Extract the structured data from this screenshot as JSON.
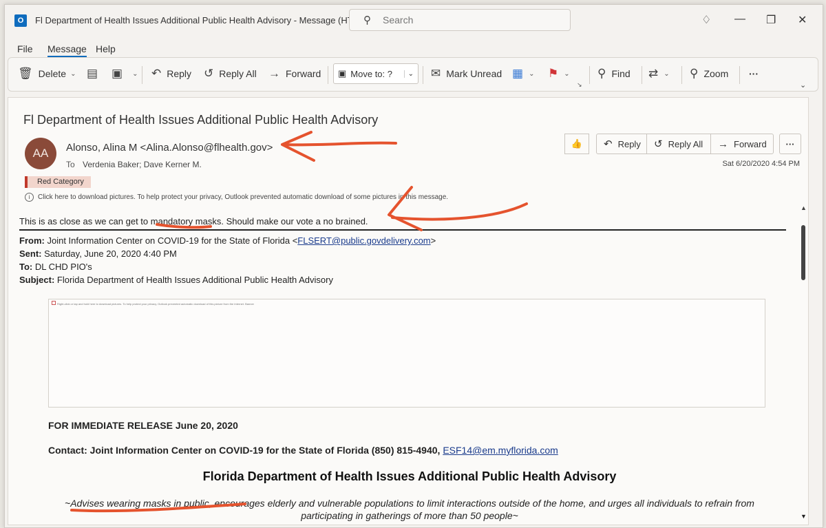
{
  "window": {
    "app_icon": "O",
    "title": "Fl Department of Health Issues Additional Public Health Advisory  -  Message (HTML)",
    "search_placeholder": "Search",
    "controls": [
      "diamond-icon",
      "minimize-icon",
      "restore-icon",
      "close-icon"
    ]
  },
  "menu": {
    "tabs": [
      {
        "label": "File"
      },
      {
        "label": "Message",
        "active": true
      },
      {
        "label": "Help"
      }
    ]
  },
  "ribbon": {
    "delete": "Delete",
    "reply": "Reply",
    "reply_all": "Reply All",
    "forward": "Forward",
    "move_to": "Move to: ?",
    "mark_unread": "Mark Unread",
    "find": "Find",
    "zoom": "Zoom",
    "more": "···"
  },
  "message": {
    "subject": "Fl Department of Health Issues Additional Public Health Advisory",
    "avatar_initials": "AA",
    "sender": "Alonso, Alina M <Alina.Alonso@flhealth.gov>",
    "to_label": "To",
    "recipients": "Verdenia Baker; Dave Kerner M.",
    "category": "Red Category",
    "info_bar": "Click here to download pictures. To help protect your privacy, Outlook prevented automatic download of some pictures in this message.",
    "datetime": "Sat 6/20/2020 4:54 PM",
    "actions": {
      "reply": "Reply",
      "reply_all": "Reply All",
      "forward": "Forward",
      "more": "···"
    },
    "body_line": "This is as close as we can get to mandatory masks. Should make our vote a no brained.",
    "forward_header": {
      "from_label": "From:",
      "from_text": "Joint Information Center on COVID-19 for the State of Florida <",
      "from_email": "FLSERT@public.govdelivery.com",
      "from_close": ">",
      "sent_label": "Sent:",
      "sent_value": "Saturday, June 20, 2020 4:40 PM",
      "to_label": "To:",
      "to_value": "DL CHD PIO's",
      "subject_label": "Subject:",
      "subject_value": "Florida Department of Health Issues Additional Public Health Advisory"
    },
    "image_caption": "Right-click or tap and hold here to download pictures. To help protect your privacy, Outlook prevented automatic download of this picture from the Internet. Banner",
    "release_line": "FOR IMMEDIATE RELEASE June 20, 2020",
    "contact_text": "Contact: Joint Information Center on COVID-19 for the State of Florida (850) 815-4940, ",
    "contact_email": "ESF14@em.myflorida.com",
    "press_title": "Florida Department of Health Issues Additional Public Health Advisory",
    "press_subtitle": "~Advises wearing masks in public, encourages elderly and vulnerable populations to limit interactions outside of the home, and urges all individuals to refrain from participating in gatherings of more than 50 people~"
  },
  "colors": {
    "accent": "#0f6cbd",
    "annotation": "#e5532e",
    "avatar": "#8a4a39",
    "category": "#c0392b"
  }
}
